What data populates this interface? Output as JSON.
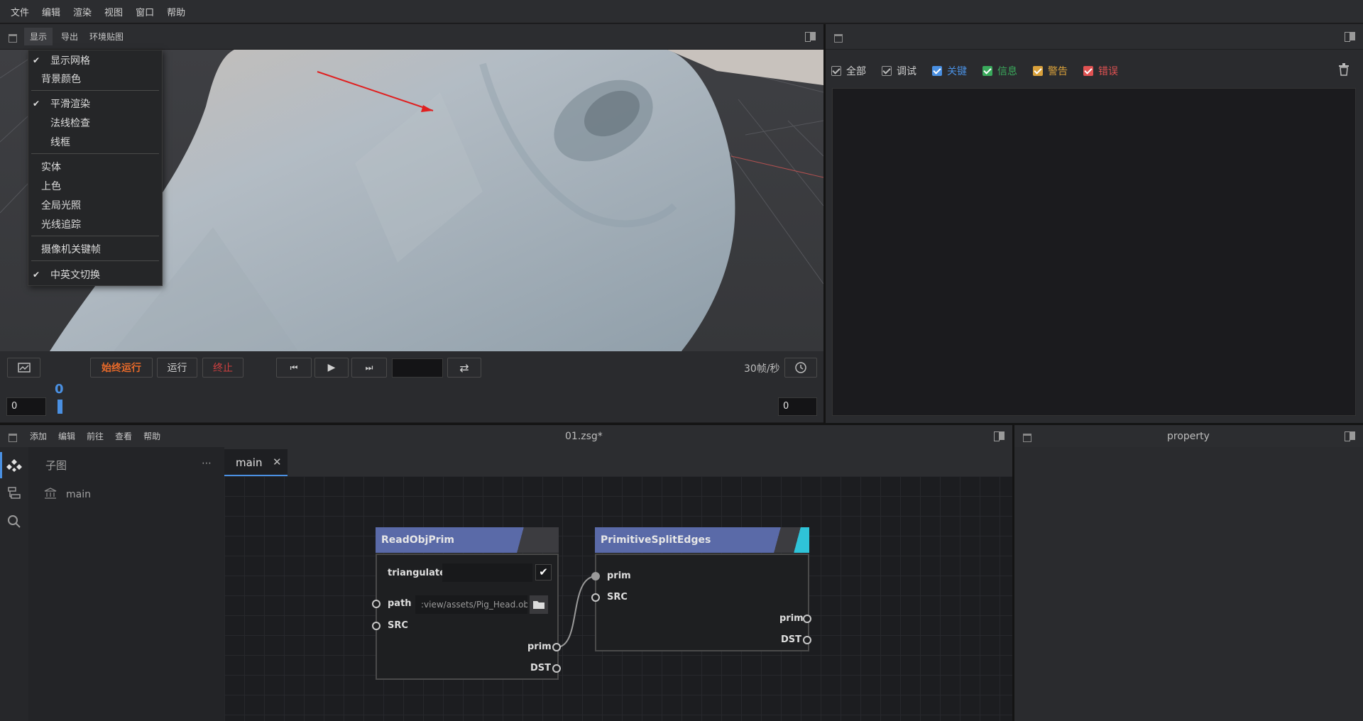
{
  "menubar": {
    "items": [
      "文件",
      "编辑",
      "渲染",
      "视图",
      "窗口",
      "帮助"
    ]
  },
  "viewport_toolbar": {
    "items": [
      "显示",
      "导出",
      "环境贴图"
    ]
  },
  "display_menu": {
    "items": [
      {
        "label": "显示网格",
        "checked": true
      },
      {
        "label": "背景颜色",
        "checked": false
      },
      {
        "label": "平滑渲染",
        "checked": true
      },
      {
        "label": "法线检查",
        "checked": false
      },
      {
        "label": "线框",
        "checked": false
      },
      {
        "label": "实体",
        "checked": false
      },
      {
        "label": "上色",
        "checked": false
      },
      {
        "label": "全局光照",
        "checked": false
      },
      {
        "label": "光线追踪",
        "checked": false
      },
      {
        "label": "摄像机关键帧",
        "checked": false
      },
      {
        "label": "中英文切换",
        "checked": true
      }
    ]
  },
  "timeline": {
    "run_always": "始终运行",
    "run": "运行",
    "stop": "终止",
    "fps": "30帧/秒",
    "start_frame": "0",
    "current_frame": "0",
    "end_frame": "0",
    "frame_input": ""
  },
  "log_panel": {
    "filters": [
      {
        "label": "全部",
        "color": "#d0d0d0",
        "style": "open"
      },
      {
        "label": "调试",
        "color": "#d0d0d0",
        "style": "open"
      },
      {
        "label": "关键",
        "color": "#4a90e2",
        "style": "filled"
      },
      {
        "label": "信息",
        "color": "#3aaa5c",
        "style": "filled"
      },
      {
        "label": "警告",
        "color": "#d9a13b",
        "style": "filled"
      },
      {
        "label": "错误",
        "color": "#e05252",
        "style": "filled"
      }
    ]
  },
  "graph_editor": {
    "menu": [
      "添加",
      "编辑",
      "前往",
      "查看",
      "帮助"
    ],
    "file_title": "01.zsg*",
    "subgraph_title": "子图",
    "subgraph_items": [
      "main"
    ],
    "tab": "main"
  },
  "property_panel": {
    "title": "property"
  },
  "nodes": {
    "read": {
      "title": "ReadObjPrim",
      "param_triangulate": "triangulate",
      "param_path": "path",
      "path_value": ":view/assets/Pig_Head.obj",
      "in_src": "SRC",
      "out_prim": "prim",
      "out_dst": "DST"
    },
    "split": {
      "title": "PrimitiveSplitEdges",
      "in_prim": "prim",
      "in_src": "SRC",
      "out_prim": "prim",
      "out_dst": "DST"
    }
  },
  "colors": {
    "accent_blue": "#4a90e2",
    "run_always": "#e86a2a",
    "stop": "#d04040",
    "node_header": "#5a6aa8",
    "node_cyan": "#2fc3d8"
  }
}
